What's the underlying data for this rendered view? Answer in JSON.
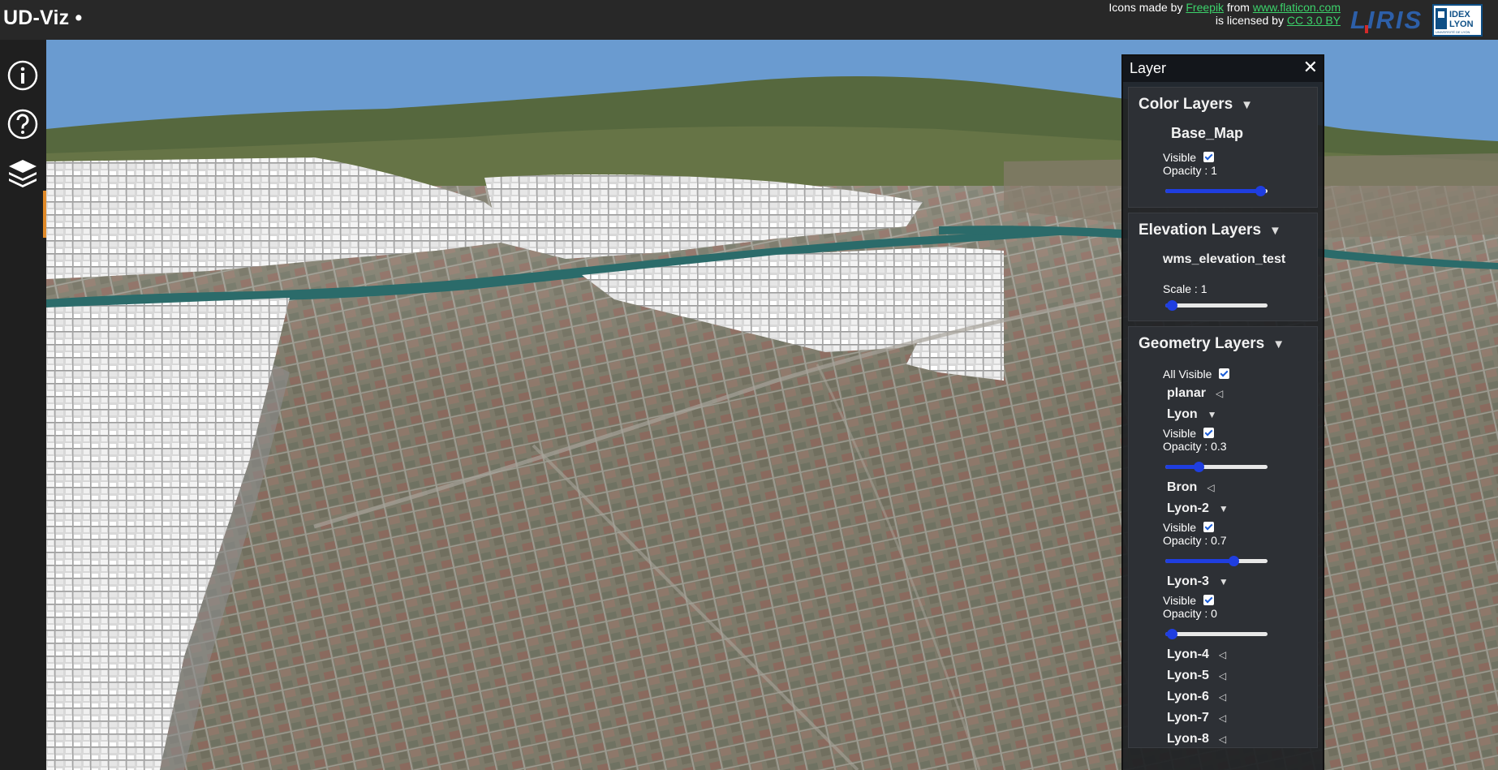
{
  "header": {
    "title": "UD-Viz •",
    "credits_line1_prefix": "Icons made by",
    "credits_author": "Freepik",
    "credits_from": "from",
    "credits_site": "www.flaticon.com",
    "credits_line2_prefix": "is licensed by",
    "credits_license": "CC 3.0 BY",
    "liris_logo_text": "LIRIS",
    "idex_logo_line1": "IDEX",
    "idex_logo_line2": "LYON",
    "idex_logo_line3": "UNIVERSITÉ DE LYON"
  },
  "sidebar": {
    "items": [
      {
        "name": "info",
        "icon": "info-icon"
      },
      {
        "name": "help",
        "icon": "help-icon"
      },
      {
        "name": "layers",
        "icon": "layers-icon",
        "active": true
      }
    ],
    "active_color": "#e08a28"
  },
  "panel": {
    "title": "Layer",
    "close": "✕",
    "color_layers": {
      "title": "Color Layers",
      "arrow": "▼",
      "layer_name": "Base_Map",
      "visible_label": "Visible",
      "visible": true,
      "opacity_label": "Opacity : 1",
      "opacity": 1
    },
    "elevation_layers": {
      "title": "Elevation Layers",
      "arrow": "▼",
      "layer_name": "wms_elevation_test",
      "scale_label": "Scale : 1",
      "scale_fraction": 0
    },
    "geometry_layers": {
      "title": "Geometry Layers",
      "arrow": "▼",
      "all_visible_label": "All Visible",
      "all_visible": true,
      "items": [
        {
          "name": "planar",
          "caret": "◁",
          "expanded": false
        },
        {
          "name": "Lyon",
          "caret": "▼",
          "expanded": true,
          "visible_label": "Visible",
          "opacity_label": "Opacity : 0.3",
          "opacity": 0.3
        },
        {
          "name": "Bron",
          "caret": "◁",
          "expanded": false
        },
        {
          "name": "Lyon-2",
          "caret": "▼",
          "expanded": true,
          "visible_label": "Visible",
          "opacity_label": "Opacity : 0.7",
          "opacity": 0.7
        },
        {
          "name": "Lyon-3",
          "caret": "▼",
          "expanded": true,
          "visible_label": "Visible",
          "opacity_label": "Opacity : 0",
          "opacity": 0
        },
        {
          "name": "Lyon-4",
          "caret": "◁",
          "expanded": false
        },
        {
          "name": "Lyon-5",
          "caret": "◁",
          "expanded": false
        },
        {
          "name": "Lyon-6",
          "caret": "◁",
          "expanded": false
        },
        {
          "name": "Lyon-7",
          "caret": "◁",
          "expanded": false
        },
        {
          "name": "Lyon-8",
          "caret": "◁",
          "expanded": false
        }
      ]
    }
  },
  "colors": {
    "header_bg": "#282828",
    "sky": "#6a9bd0",
    "slider_blue": "#1f3ee0",
    "link_green": "#3cd36b"
  }
}
